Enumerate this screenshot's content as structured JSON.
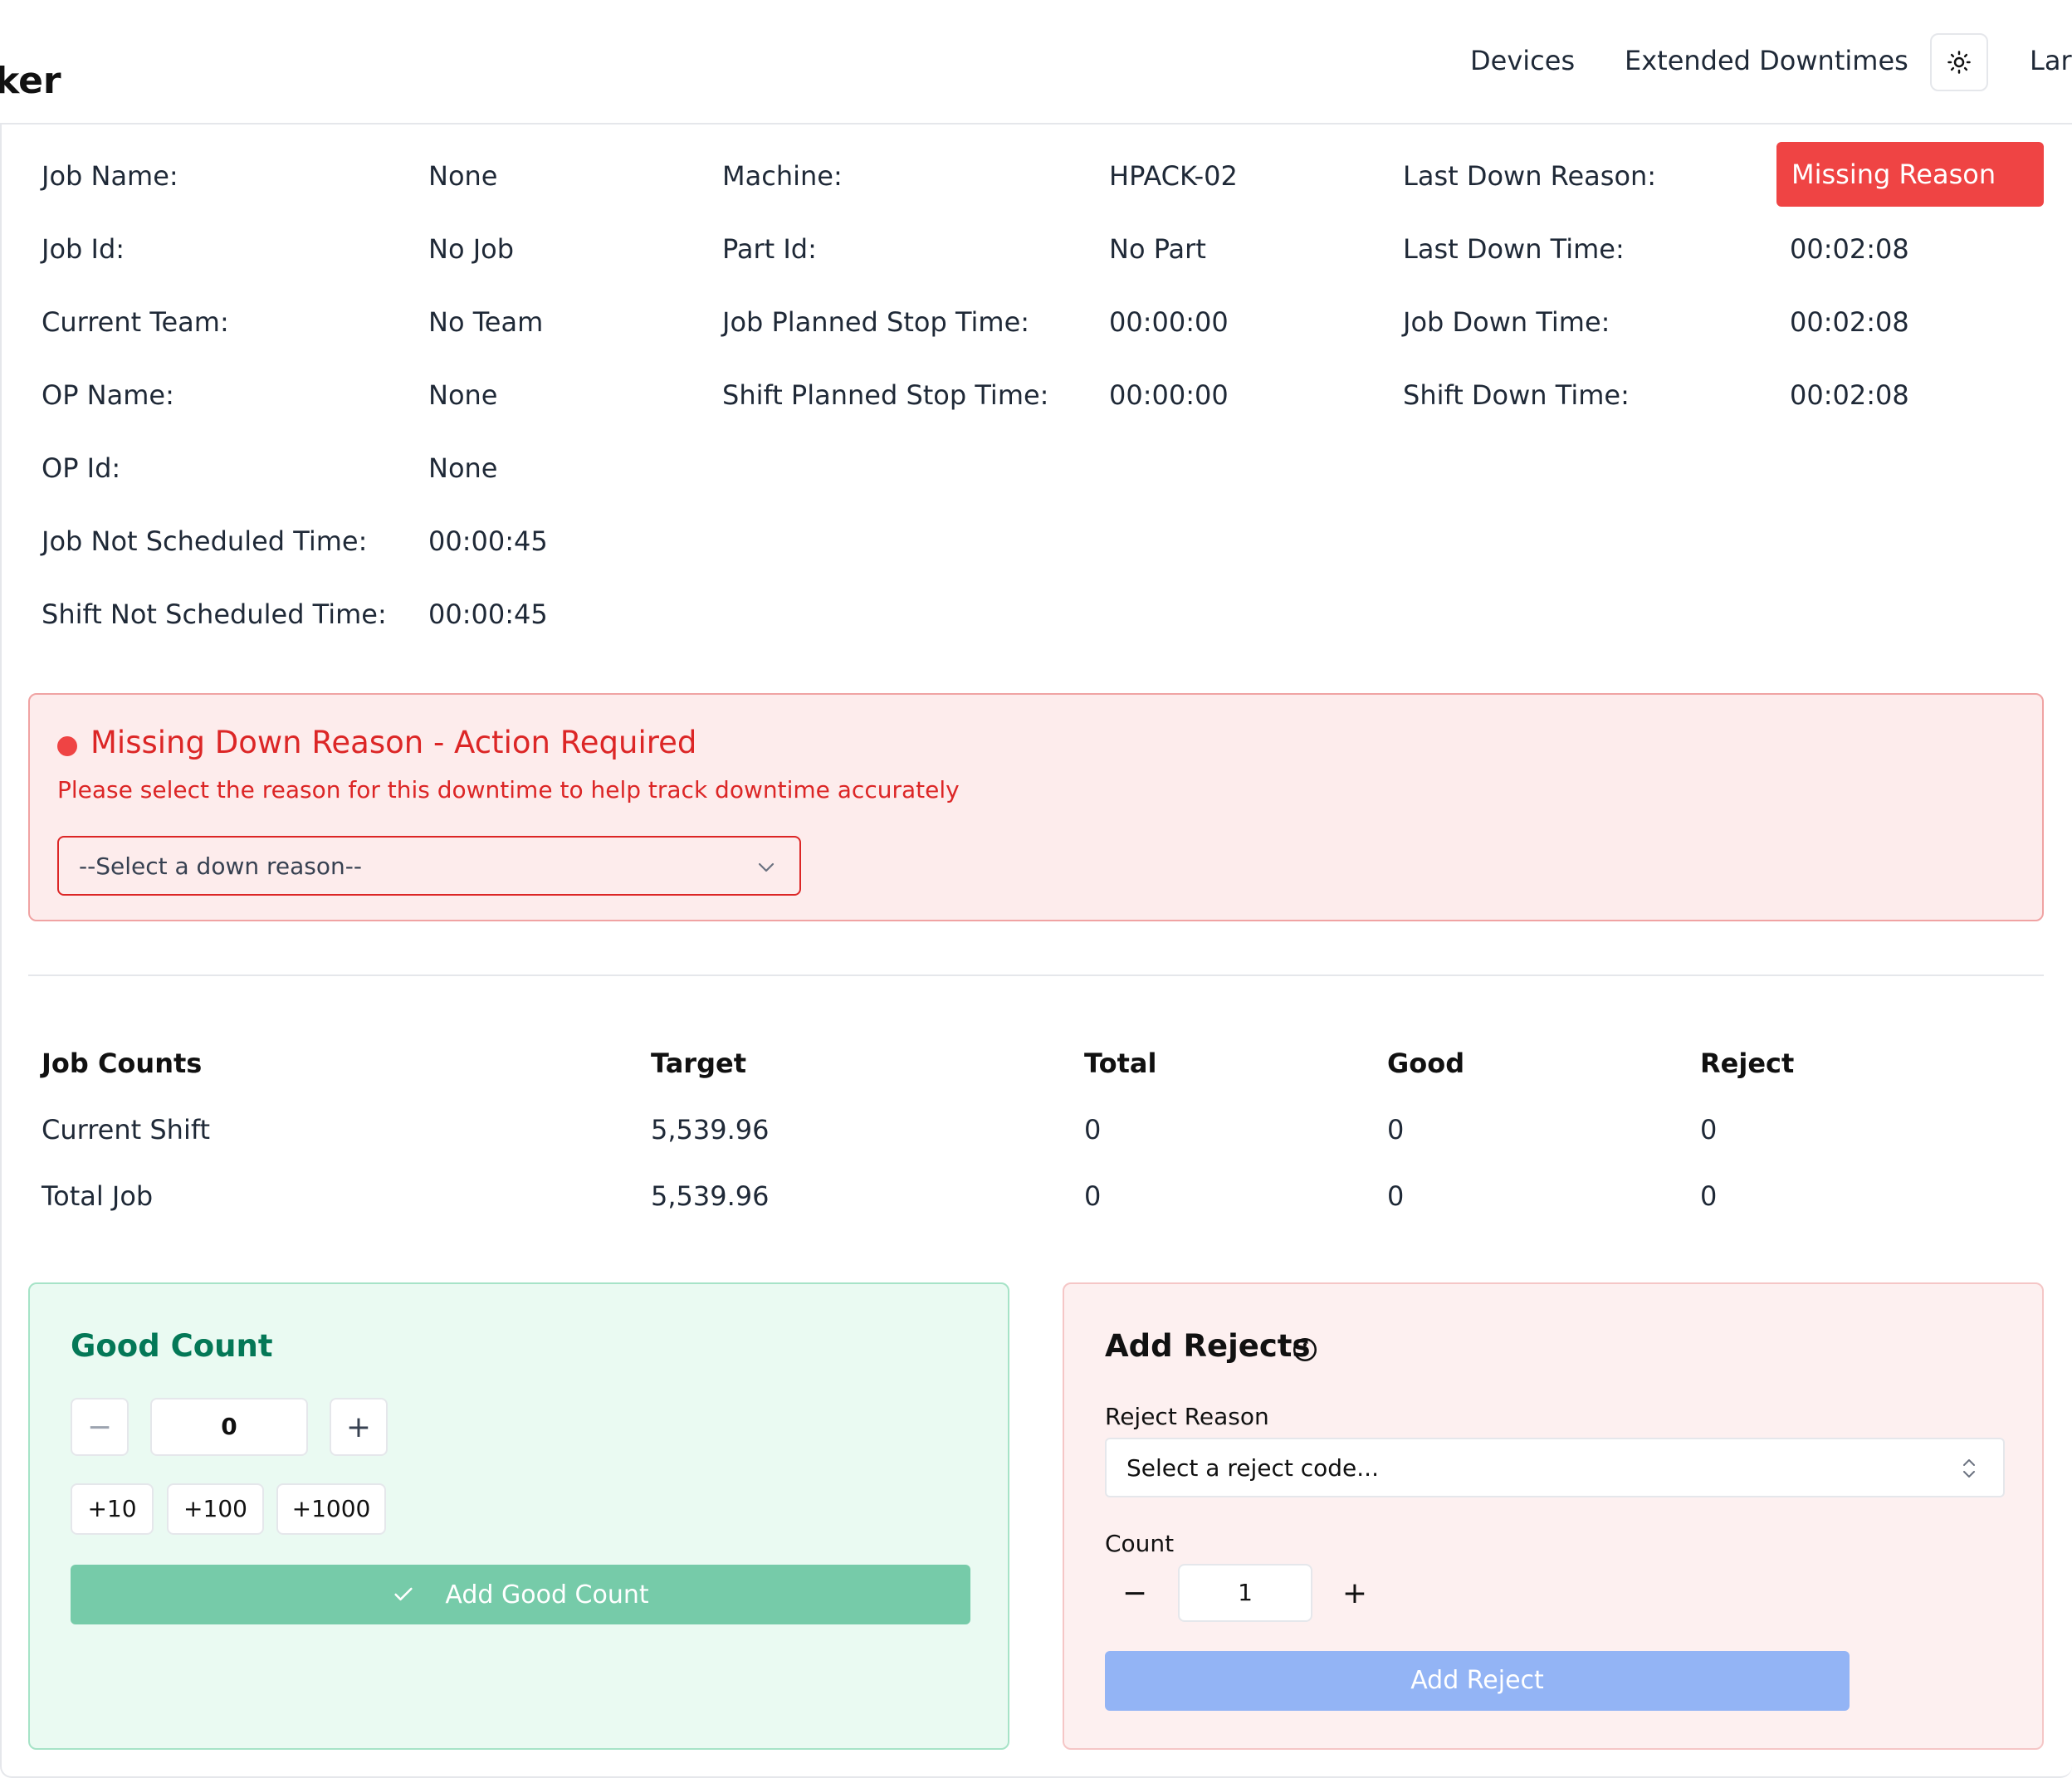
{
  "header": {
    "brand_fragment": "ker",
    "nav": [
      "Devices",
      "Extended Downtimes"
    ],
    "nav_cut": "Larg"
  },
  "info": {
    "col1": [
      {
        "label": "Job Name:",
        "value": "None"
      },
      {
        "label": "Job Id:",
        "value": "No Job"
      },
      {
        "label": "Current Team:",
        "value": "No Team"
      },
      {
        "label": "OP Name:",
        "value": "None"
      },
      {
        "label": "OP Id:",
        "value": "None"
      },
      {
        "label": "Job Not Scheduled Time:",
        "value": "00:00:45"
      },
      {
        "label": "Shift Not Scheduled Time:",
        "value": "00:00:45"
      }
    ],
    "col2": [
      {
        "label": "Machine:",
        "value": "HPACK-02"
      },
      {
        "label": "Part Id:",
        "value": "No Part"
      },
      {
        "label": "Job Planned Stop Time:",
        "value": "00:00:00"
      },
      {
        "label": "Shift Planned Stop Time:",
        "value": "00:00:00"
      }
    ],
    "col3": [
      {
        "label": "Last Down Reason:",
        "value": "Missing Reason"
      },
      {
        "label": "Last Down Time:",
        "value": "00:02:08"
      },
      {
        "label": "Job Down Time:",
        "value": "00:02:08"
      },
      {
        "label": "Shift Down Time:",
        "value": "00:02:08"
      }
    ]
  },
  "alert": {
    "title": "Missing Down Reason - Action Required",
    "subtitle": "Please select the reason for this downtime to help track downtime accurately",
    "select_placeholder": "--Select a down reason--"
  },
  "counts": {
    "headers": [
      "Job Counts",
      "Target",
      "Total",
      "Good",
      "Reject"
    ],
    "rows": [
      [
        "Current Shift",
        "5,539.96",
        "0",
        "0",
        "0"
      ],
      [
        "Total Job",
        "5,539.96",
        "0",
        "0",
        "0"
      ]
    ]
  },
  "good": {
    "title": "Good Count",
    "value": "0",
    "minus": "−",
    "plus": "+",
    "quick": [
      "+10",
      "+100",
      "+1000"
    ],
    "submit": "Add Good Count"
  },
  "reject": {
    "title": "Add Rejects",
    "reason_label": "Reject Reason",
    "reason_placeholder": "Select a reject code...",
    "count_label": "Count",
    "count_value": "1",
    "minus": "−",
    "plus": "+",
    "submit": "Add Reject"
  },
  "colors": {
    "alert_red": "#ef4444",
    "good_green": "#047857",
    "good_button": "#76cba9",
    "reject_button": "#93b4f5"
  }
}
